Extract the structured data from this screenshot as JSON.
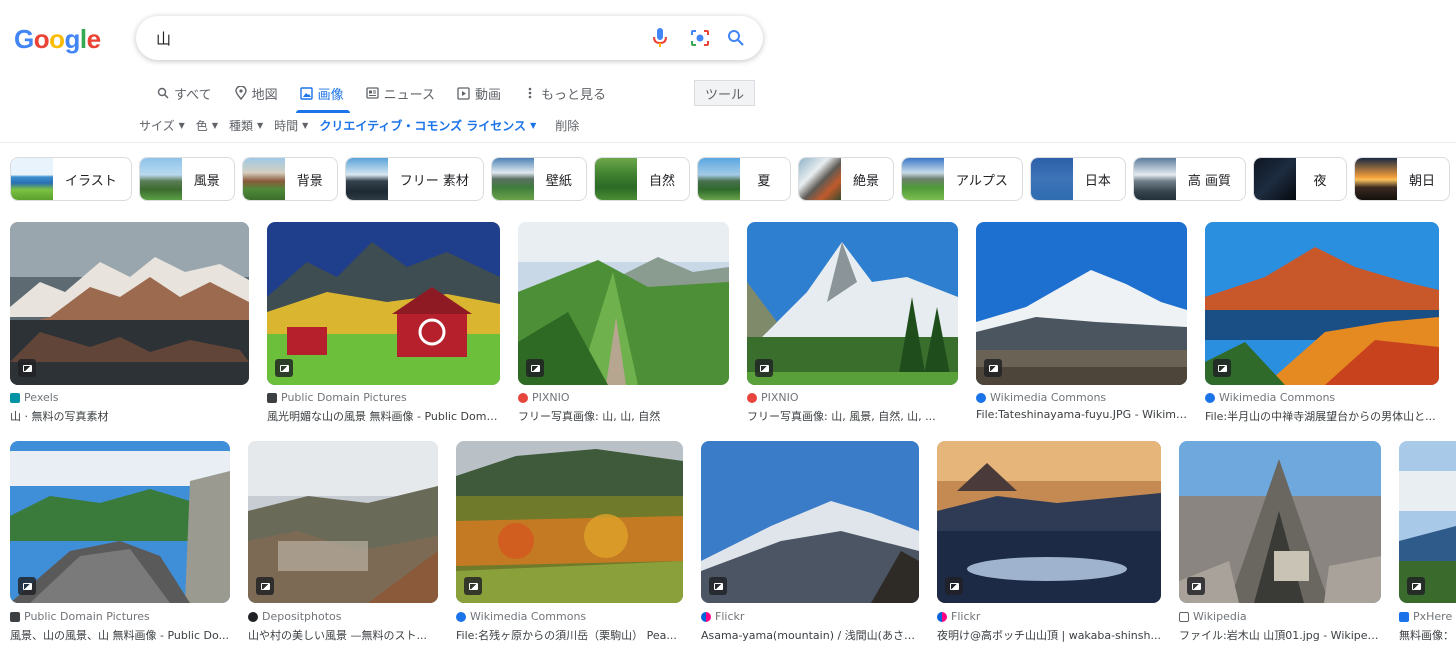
{
  "logo": [
    "G",
    "o",
    "o",
    "g",
    "l",
    "e"
  ],
  "logo_colors": [
    "#4285f4",
    "#ea4335",
    "#fbbc05",
    "#4285f4",
    "#34a853",
    "#ea4335"
  ],
  "search": {
    "query": "山"
  },
  "icons": {
    "mic": "mic-icon",
    "lens": "camera-lens-icon",
    "search": "search-icon"
  },
  "tabs": [
    {
      "label": "すべて",
      "icon": "search-icon"
    },
    {
      "label": "地図",
      "icon": "map-pin-icon"
    },
    {
      "label": "画像",
      "icon": "image-icon"
    },
    {
      "label": "ニュース",
      "icon": "news-icon"
    },
    {
      "label": "動画",
      "icon": "video-icon"
    },
    {
      "label": "もっと見る",
      "icon": "more-vert-icon"
    }
  ],
  "tools_label": "ツール",
  "filters": {
    "size": "サイズ",
    "color": "色",
    "type": "種類",
    "time": "時間",
    "license": "クリエイティブ・コモンズ ライセンス",
    "clear": "削除"
  },
  "chips": [
    "イラスト",
    "風景",
    "背景",
    "フリー 素材",
    "壁紙",
    "自然",
    "夏",
    "絶景",
    "アルプス",
    "日本",
    "高 画質",
    "夜",
    "朝日"
  ],
  "results": [
    {
      "source": "Pexels",
      "title": "山 · 無料の写真素材",
      "fav": "#0093a5"
    },
    {
      "source": "Public Domain Pictures",
      "title": "風光明媚な山の風景 無料画像 - Public Doma...",
      "fav": "#3c4043"
    },
    {
      "source": "PIXNIO",
      "title": "フリー写真画像: 山, 山, 自然",
      "fav": "#e8453c"
    },
    {
      "source": "PIXNIO",
      "title": "フリー写真画像: 山, 風景, 自然, 山, ...",
      "fav": "#e8453c"
    },
    {
      "source": "Wikimedia Commons",
      "title": "File:Tateshinayama-fuyu.JPG - Wikime...",
      "fav": "#1a73e8"
    },
    {
      "source": "Wikimedia Commons",
      "title": "File:半月山の中禅寺湖展望台からの男体山と...",
      "fav": "#1a73e8"
    },
    {
      "source": "Public Domain Pictures",
      "title": "風景、山の風景、山 無料画像 - Public Do...",
      "fav": "#3c4043"
    },
    {
      "source": "Depositphotos",
      "title": "山や村の美しい風景 —無料のスト...",
      "fav": "#202124"
    },
    {
      "source": "Wikimedia Commons",
      "title": "File:名残ヶ原からの須川岳（栗駒山） Pea...",
      "fav": "#1a73e8"
    },
    {
      "source": "Flickr",
      "title": "Asama-yama(mountain) / 浅間山(あさま...",
      "fav": "#0063dc"
    },
    {
      "source": "Flickr",
      "title": "夜明け@高ボッチ山山頂 | wakaba-shinsh...",
      "fav": "#0063dc"
    },
    {
      "source": "Wikipedia",
      "title": "ファイル:岩木山 山頂01.jpg - Wikipedia",
      "fav": "#5f6368"
    },
    {
      "source": "PxHere",
      "title": "無料画像：",
      "fav": "#1a73e8"
    }
  ]
}
